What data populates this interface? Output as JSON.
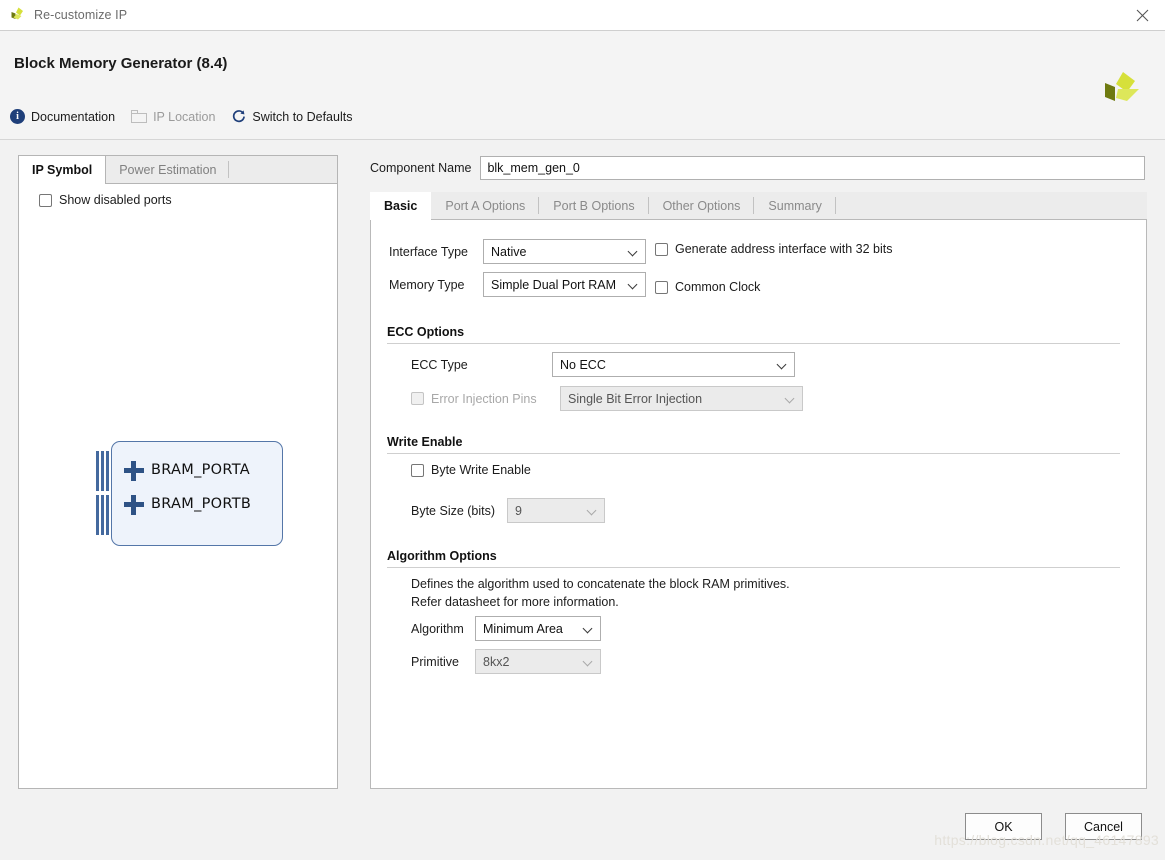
{
  "window": {
    "title": "Re-customize IP",
    "close_icon": "close-icon"
  },
  "header": {
    "title": "Block Memory Generator (8.4)",
    "logo_icon": "xilinx-logo-icon",
    "actions": [
      {
        "label": "Documentation",
        "icon": "info-icon",
        "enabled": true
      },
      {
        "label": "IP Location",
        "icon": "folder-icon",
        "enabled": false
      },
      {
        "label": "Switch to Defaults",
        "icon": "refresh-icon",
        "enabled": true
      }
    ]
  },
  "left_panel": {
    "tabs": [
      {
        "label": "IP Symbol",
        "active": true
      },
      {
        "label": "Power Estimation",
        "active": false
      }
    ],
    "show_disabled_ports": {
      "label": "Show disabled ports",
      "checked": false
    },
    "symbol": {
      "ports": [
        {
          "label": "BRAM_PORTA"
        },
        {
          "label": "BRAM_PORTB"
        }
      ]
    }
  },
  "right_panel": {
    "component_name": {
      "label": "Component Name",
      "value": "blk_mem_gen_0"
    },
    "tabs": [
      {
        "label": "Basic",
        "active": true
      },
      {
        "label": "Port A Options",
        "active": false
      },
      {
        "label": "Port B Options",
        "active": false
      },
      {
        "label": "Other Options",
        "active": false
      },
      {
        "label": "Summary",
        "active": false
      }
    ],
    "basic": {
      "interface_type": {
        "label": "Interface Type",
        "value": "Native"
      },
      "memory_type": {
        "label": "Memory Type",
        "value": "Simple Dual Port RAM"
      },
      "generate_address_interface": {
        "label": "Generate address interface with 32 bits",
        "checked": false
      },
      "common_clock": {
        "label": "Common Clock",
        "checked": false
      },
      "ecc_options": {
        "title": "ECC Options",
        "ecc_type": {
          "label": "ECC Type",
          "value": "No ECC",
          "enabled": true
        },
        "error_injection_pins": {
          "label": "Error Injection Pins",
          "checked": false,
          "enabled": false
        },
        "error_injection_type": {
          "value": "Single Bit Error Injection",
          "enabled": false
        }
      },
      "write_enable": {
        "title": "Write Enable",
        "byte_write_enable": {
          "label": "Byte Write Enable",
          "checked": false
        },
        "byte_size": {
          "label": "Byte Size (bits)",
          "value": "9",
          "enabled": false
        }
      },
      "algorithm_options": {
        "title": "Algorithm Options",
        "description_line1": "Defines the algorithm used to concatenate the block RAM primitives.",
        "description_line2": "Refer datasheet for more information.",
        "algorithm": {
          "label": "Algorithm",
          "value": "Minimum Area",
          "enabled": true
        },
        "primitive": {
          "label": "Primitive",
          "value": "8kx2",
          "enabled": false
        }
      }
    }
  },
  "footer": {
    "ok_label": "OK",
    "cancel_label": "Cancel",
    "watermark": "https://blog.csdn.net/qq_46147893"
  },
  "colors": {
    "accent_blue": "#1f3f7a",
    "symbol_fill": "#eef3fb",
    "symbol_border": "#5476a8",
    "logo_light": "#d6e03a",
    "logo_dark": "#6e7a10"
  }
}
